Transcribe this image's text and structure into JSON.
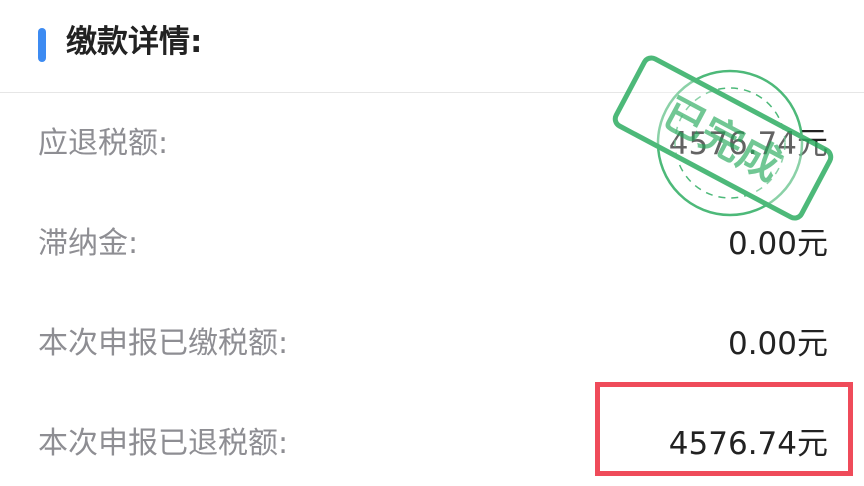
{
  "section": {
    "title": "缴款详情:"
  },
  "rows": [
    {
      "label": "应退税额:",
      "value": "4576.74元"
    },
    {
      "label": "滞纳金:",
      "value": "0.00元"
    },
    {
      "label": "本次申报已缴税额:",
      "value": "0.00元"
    },
    {
      "label": "本次申报已退税额:",
      "value": "4576.74元"
    }
  ],
  "stamp": {
    "text": "已完成",
    "color": "#2ead62"
  },
  "colors": {
    "accent": "#3d8bf2",
    "highlight": "#ef4b5a",
    "label": "#8e8e93",
    "value": "#222222"
  }
}
